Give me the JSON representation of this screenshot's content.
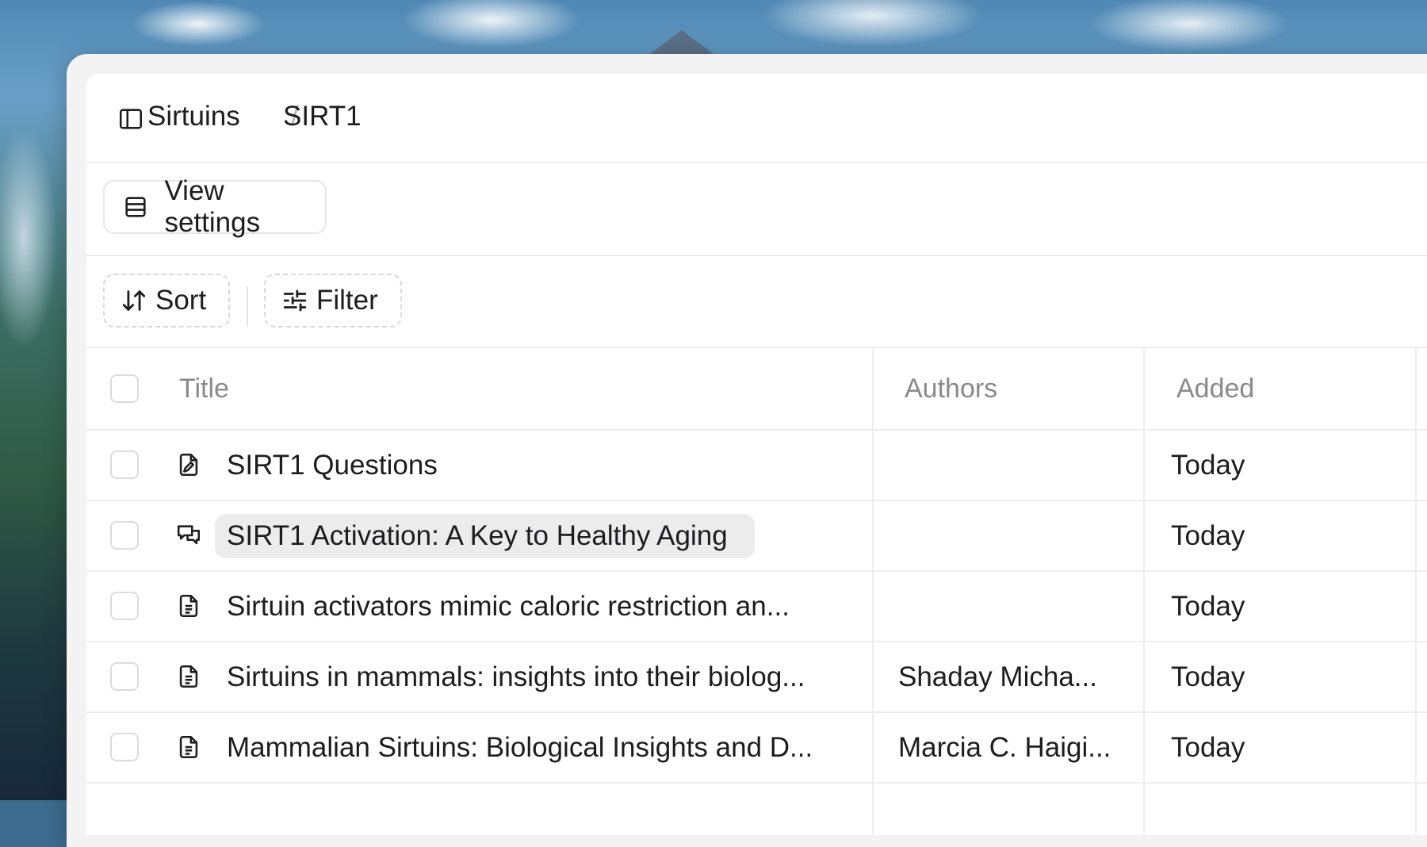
{
  "breadcrumb": {
    "parent": "Sirtuins",
    "separator": "/",
    "current": "SIRT1"
  },
  "toolbar": {
    "view_settings_label": "View settings",
    "sort_label": "Sort",
    "filter_label": "Filter"
  },
  "table": {
    "columns": {
      "title": "Title",
      "authors": "Authors",
      "added": "Added"
    },
    "rows": [
      {
        "icon": "note-edit-icon",
        "title": "SIRT1 Questions",
        "authors": "",
        "added": "Today"
      },
      {
        "icon": "chat-icon",
        "title": "SIRT1 Activation: A Key to Healthy Aging",
        "authors": "",
        "added": "Today"
      },
      {
        "icon": "document-icon",
        "title": "Sirtuin activators mimic caloric restriction an...",
        "authors": "",
        "added": "Today"
      },
      {
        "icon": "document-icon",
        "title": "Sirtuins in mammals: insights into their biolog...",
        "authors": "Shaday Micha...",
        "added": "Today"
      },
      {
        "icon": "document-icon",
        "title": "Mammalian Sirtuins: Biological Insights and D...",
        "authors": "Marcia C. Haigi...",
        "added": "Today"
      }
    ]
  }
}
